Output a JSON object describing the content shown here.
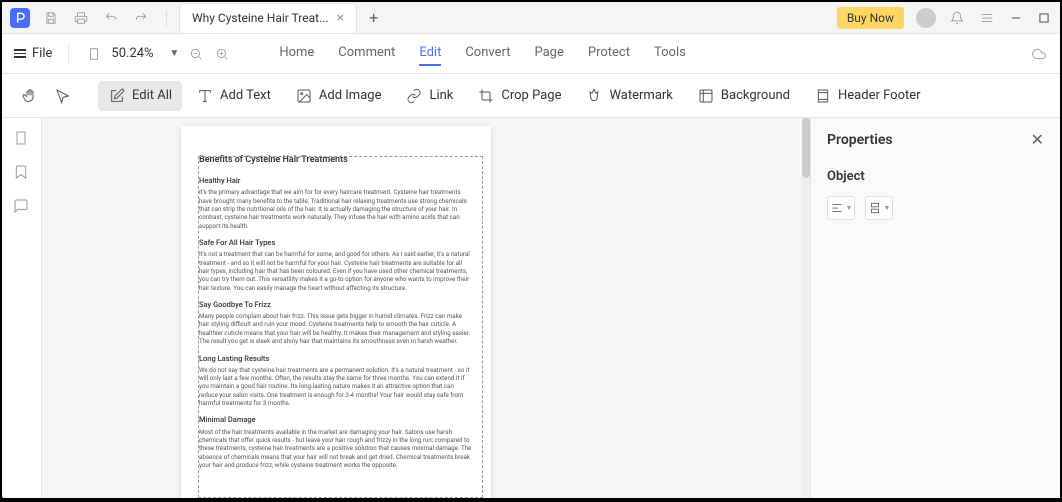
{
  "titlebar": {
    "tab_title": "Why Cysteine Hair Treat...",
    "buy_now": "Buy Now"
  },
  "menubar": {
    "file": "File",
    "zoom": "50.24%",
    "tabs": [
      "Home",
      "Comment",
      "Edit",
      "Convert",
      "Page",
      "Protect",
      "Tools"
    ],
    "active_tab": 2
  },
  "toolbar": {
    "edit_all": "Edit All",
    "add_text": "Add Text",
    "add_image": "Add Image",
    "link": "Link",
    "crop_page": "Crop Page",
    "watermark": "Watermark",
    "background": "Background",
    "header_footer": "Header  Footer"
  },
  "properties": {
    "title": "Properties",
    "subtitle": "Object"
  },
  "document": {
    "title": "Benefits of Cysteine Hair Treatments",
    "sections": [
      {
        "h": "Healthy Hair",
        "p": "It's the primary advantage that we aim for for every haircare treatment. Cysteine hair treatments have brought many benefits to the table. Traditional hair relaxing treatments use strong chemicals that can strip the nutritional oils of the hair. It is actually damaging the structure of your hair. In contrast, cysteine hair treatments work naturally. They infuse the hair with amino acids that can support its health."
      },
      {
        "h": "Safe For All Hair Types",
        "p": "It's not a treatment that can be harmful for some, and good for others. As I said earlier, it's a natural treatment - and so it will not be harmful for your hair. Cysteine hair treatments are suitable for all hair types, including hair that has been coloured. Even if you have used other chemical treatments, you can try them out. This versatility makes it a go-to option for anyone who wants to improve their hair texture. You can easily manage the heart without affecting its structure."
      },
      {
        "h": "Say Goodbye To Frizz",
        "p": "Many people complain about hair frizz. This issue gets bigger in humid climates. Frizz can make hair styling difficult and ruin your mood. Cysteine treatments help to smooth the hair cuticle. A healthier cuticle means that your hair will be healthy. It makes their management and styling easier. The result you get is sleek and shiny hair that maintains its smoothness even in harsh weather."
      },
      {
        "h": "Long Lasting Results",
        "p": "We do not say that cysteine hair treatments are a permanent solution. It's a natural treatment - so it will only last a few months. Often, the results stay the same for three months. You can extend it if you maintain a good hair routine. Its long-lasting nature makes it an attractive option that can reduce your salon visits. One treatment is enough for 3-4 months! Your hair would stay safe from harmful treatments for 3 months."
      },
      {
        "h": "Minimal Damage",
        "p": "Most of the hair treatments available in the market are damaging your hair. Salons use harsh chemicals that offer quick results - but leave your hair rough and frizzy in the long run; compared to these treatments, cysteine hair treatments are a positive solution that causes minimal damage. The absence of chemicals means that your hair will not break and get dried. Chemical treatments break your hair and produce frizz, while cysteine treatment works the opposite."
      }
    ]
  }
}
